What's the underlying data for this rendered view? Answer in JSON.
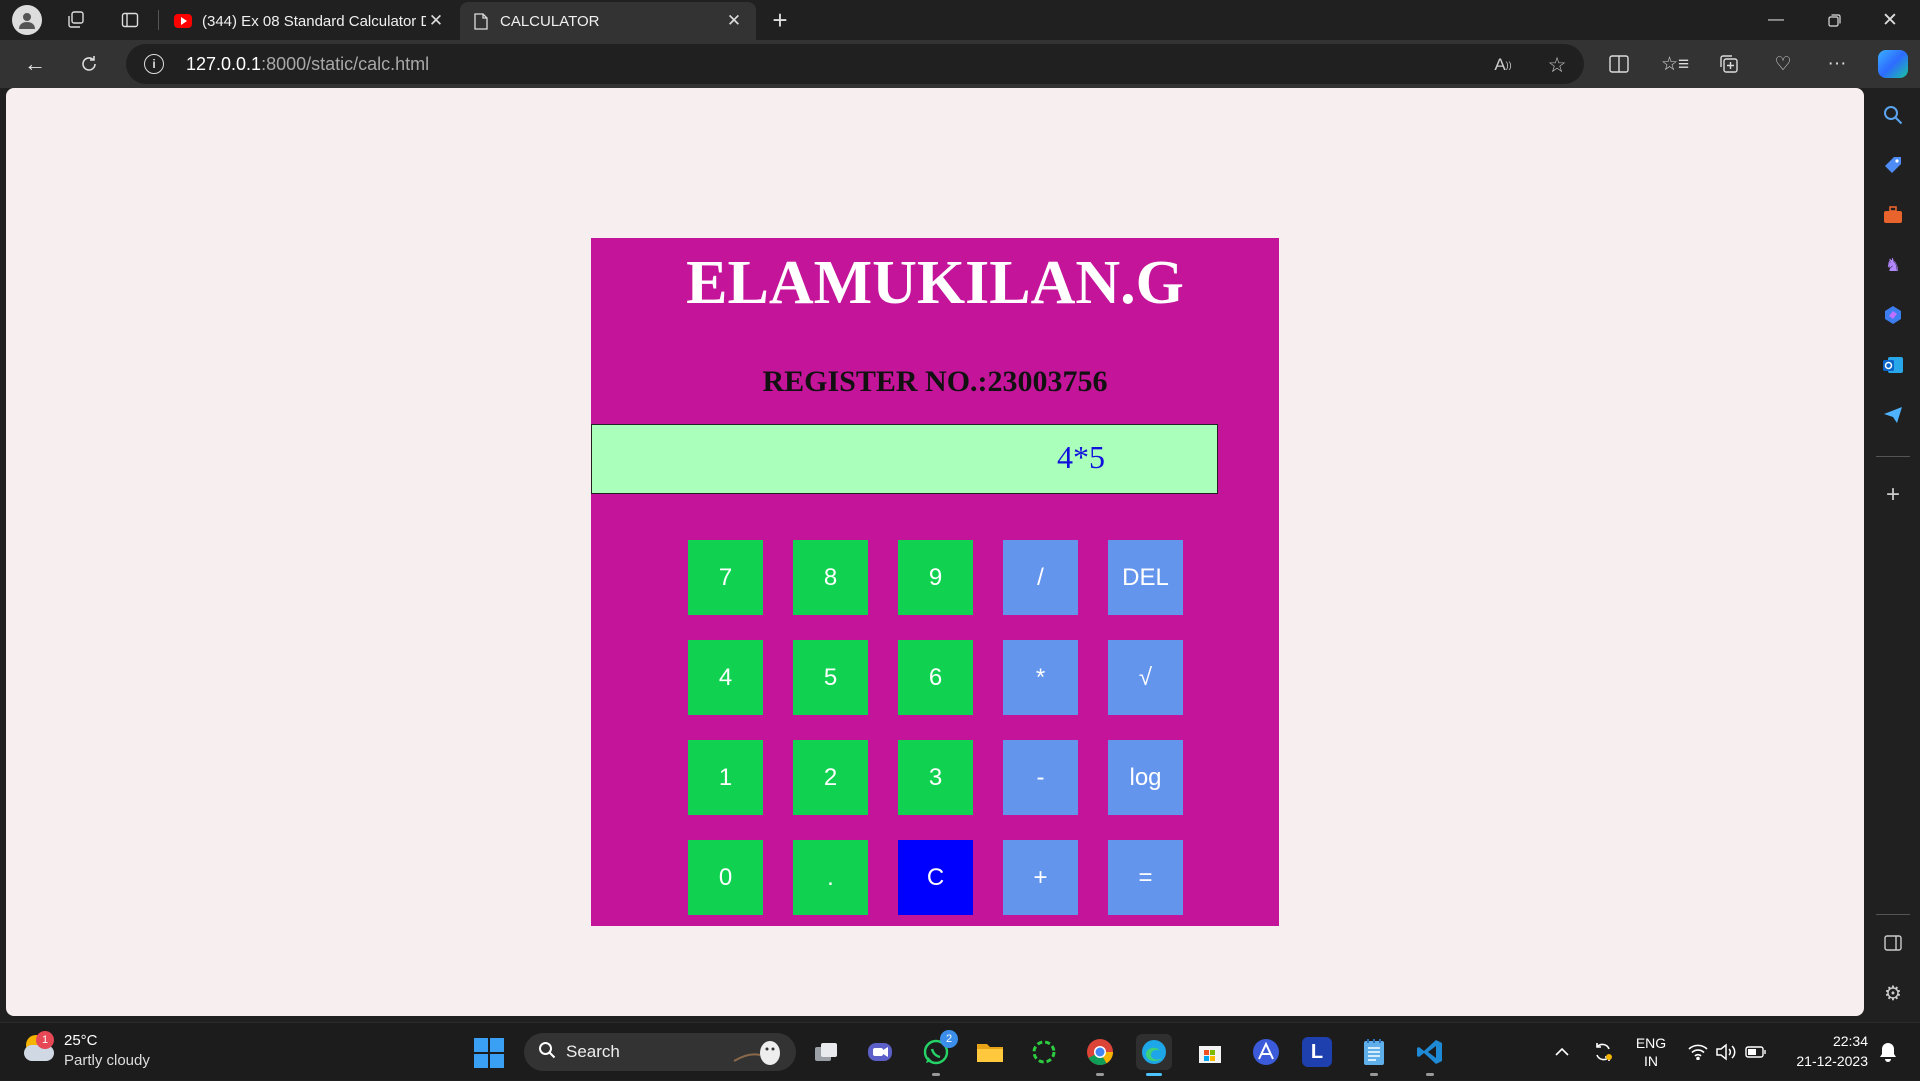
{
  "browser": {
    "tabs": [
      {
        "label": "(344) Ex 08 Standard Calculator D",
        "favicon": "youtube-icon"
      },
      {
        "label": "CALCULATOR",
        "favicon": "page-icon",
        "active": true
      }
    ],
    "url_host": "127.0.0.1",
    "url_rest": ":8000/static/calc.html"
  },
  "page": {
    "title": "ELAMUKILAN.G",
    "register": "REGISTER NO.:23003756",
    "display_value": "4*5",
    "keys": [
      {
        "label": "7",
        "kind": "num"
      },
      {
        "label": "8",
        "kind": "num"
      },
      {
        "label": "9",
        "kind": "num"
      },
      {
        "label": "/",
        "kind": "op"
      },
      {
        "label": "DEL",
        "kind": "op"
      },
      {
        "label": "4",
        "kind": "num"
      },
      {
        "label": "5",
        "kind": "num"
      },
      {
        "label": "6",
        "kind": "num"
      },
      {
        "label": "*",
        "kind": "op"
      },
      {
        "label": "√",
        "kind": "op"
      },
      {
        "label": "1",
        "kind": "num"
      },
      {
        "label": "2",
        "kind": "num"
      },
      {
        "label": "3",
        "kind": "num"
      },
      {
        "label": "-",
        "kind": "op"
      },
      {
        "label": "log",
        "kind": "op"
      },
      {
        "label": "0",
        "kind": "num"
      },
      {
        "label": ".",
        "kind": "num"
      },
      {
        "label": "C",
        "kind": "clear"
      },
      {
        "label": "+",
        "kind": "op"
      },
      {
        "label": "=",
        "kind": "op"
      }
    ],
    "colors": {
      "panel": "#c4159a",
      "display": "#aaffbb",
      "number_key": "#11d150",
      "operator_key": "#6495ed",
      "clear_key": "#0000ff"
    }
  },
  "taskbar": {
    "weather_temp": "25°C",
    "weather_desc": "Partly cloudy",
    "weather_badge": "1",
    "search_label": "Search",
    "whatsapp_badge": "2",
    "lang_top": "ENG",
    "lang_bottom": "IN",
    "time": "22:34",
    "date": "21-12-2023"
  }
}
